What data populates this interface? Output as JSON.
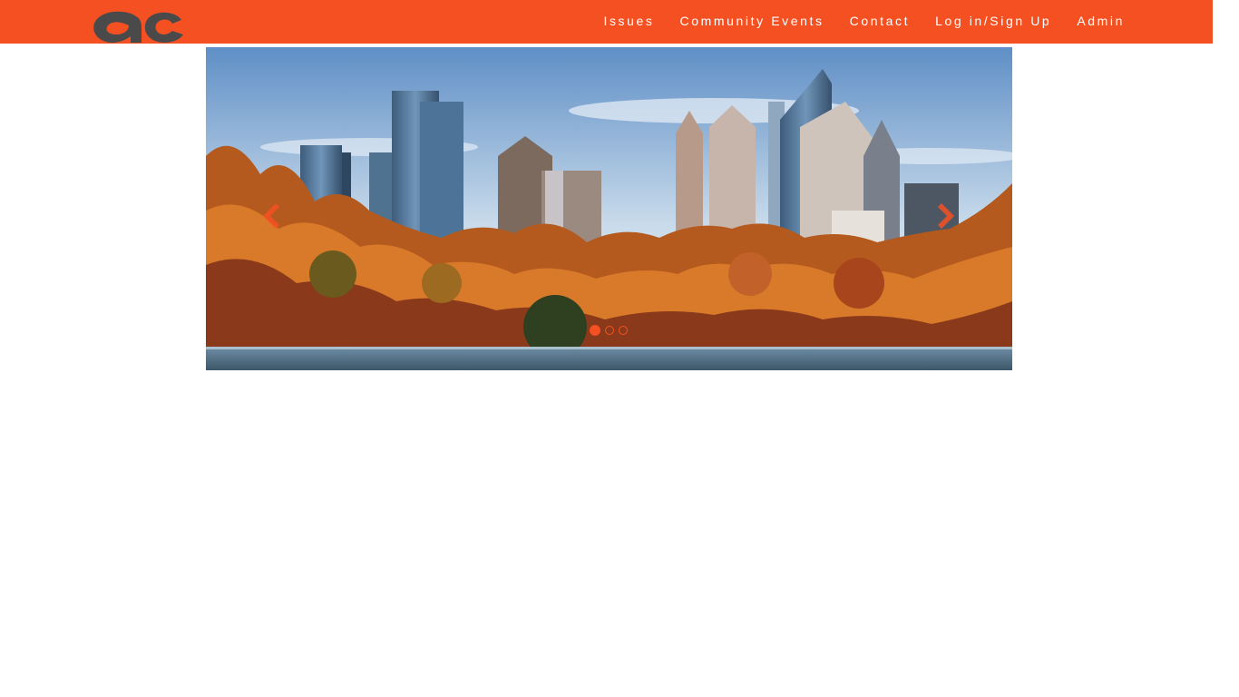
{
  "brand": {
    "logo_text": "ac",
    "accent_color": "#f55022",
    "logo_color": "#4a4a4a"
  },
  "nav": {
    "items": [
      {
        "label": "Issues"
      },
      {
        "label": "Community Events"
      },
      {
        "label": "Contact"
      },
      {
        "label": "Log in/Sign Up"
      },
      {
        "label": "Admin"
      }
    ]
  },
  "carousel": {
    "slide_count": 3,
    "active_slide": 1,
    "prev_icon": "chevron-left-icon",
    "next_icon": "chevron-right-icon",
    "image": "city skyline over autumn trees and lake"
  }
}
